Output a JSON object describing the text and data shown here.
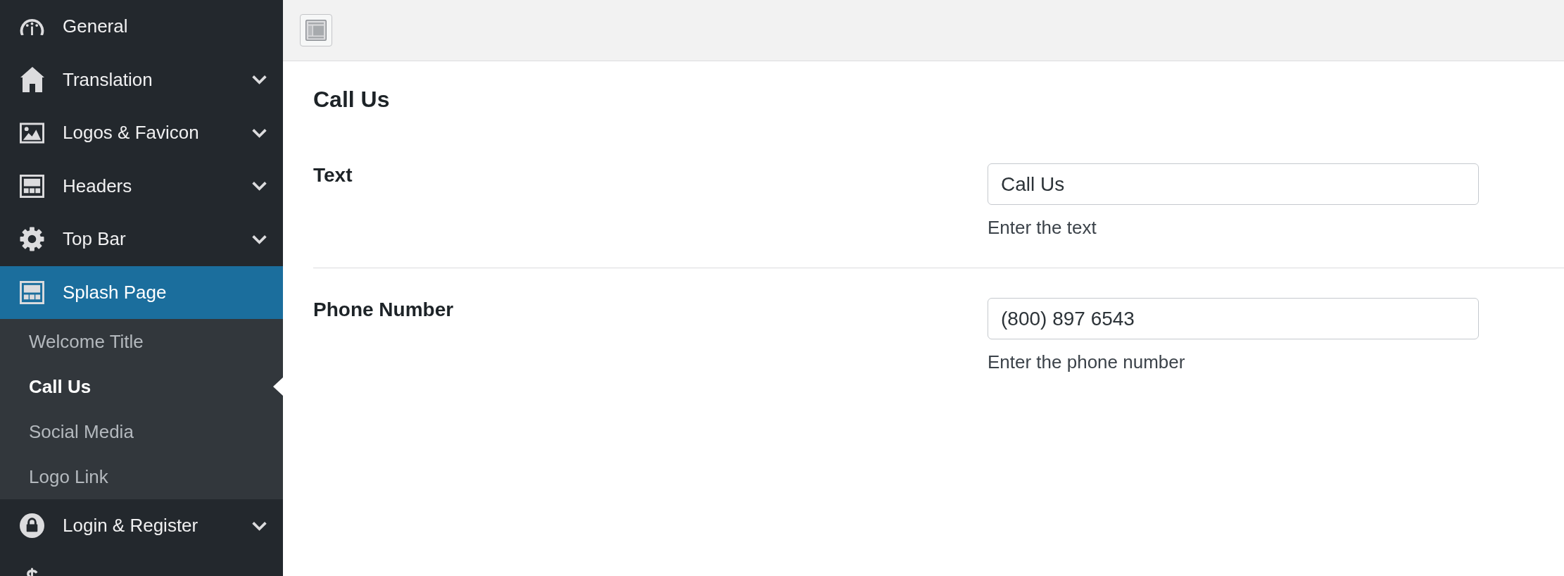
{
  "sidebar": {
    "items": [
      {
        "label": "General",
        "selected": false
      },
      {
        "label": "Translation",
        "selected": false,
        "expanded": false
      },
      {
        "label": "Logos & Favicon",
        "selected": false,
        "expanded": false
      },
      {
        "label": "Headers",
        "selected": false,
        "expanded": false
      },
      {
        "label": "Top Bar",
        "selected": false,
        "expanded": false
      },
      {
        "label": "Splash Page",
        "selected": true,
        "expanded": true,
        "children": [
          {
            "label": "Welcome Title",
            "selected": false
          },
          {
            "label": "Call Us",
            "selected": true
          },
          {
            "label": "Social Media",
            "selected": false
          },
          {
            "label": "Logo Link",
            "selected": false
          }
        ]
      },
      {
        "label": "Login & Register",
        "selected": false,
        "expanded": false
      },
      {
        "selected": false
      }
    ]
  },
  "section": {
    "title": "Call Us",
    "fields": [
      {
        "label": "Text",
        "value": "Call Us",
        "description": "Enter the text"
      },
      {
        "label": "Phone Number",
        "value": "(800) 897 6543",
        "description": "Enter the phone number"
      }
    ]
  }
}
